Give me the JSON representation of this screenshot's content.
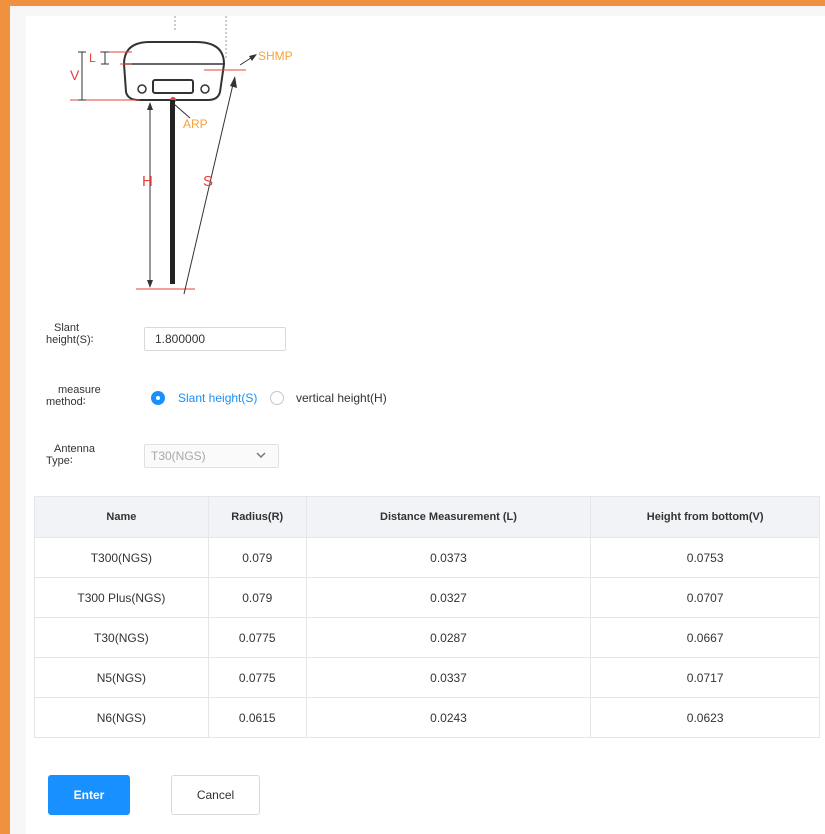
{
  "diagram": {
    "labels": {
      "v": "V",
      "l": "L",
      "shmp": "SHMP",
      "arp": "ARP",
      "h": "H",
      "s": "S"
    }
  },
  "form": {
    "slant_height": {
      "label_line1": "Slant",
      "label_line2": "height(S)∶",
      "value": "1.800000"
    },
    "measure_method": {
      "label_line1": "measure",
      "label_line2": "method∶",
      "options": [
        {
          "label": "Slant height(S)",
          "selected": true
        },
        {
          "label": "vertical height(H)",
          "selected": false
        }
      ]
    },
    "antenna_type": {
      "label_line1": "Antenna",
      "label_line2": "Type∶",
      "value": "T30(NGS)"
    }
  },
  "table": {
    "headers": [
      "Name",
      "Radius(R)",
      "Distance Measurement (L)",
      "Height from bottom(V)"
    ],
    "rows": [
      [
        "T300(NGS)",
        "0.079",
        "0.0373",
        "0.0753"
      ],
      [
        "T300 Plus(NGS)",
        "0.079",
        "0.0327",
        "0.0707"
      ],
      [
        "T30(NGS)",
        "0.0775",
        "0.0287",
        "0.0667"
      ],
      [
        "N5(NGS)",
        "0.0775",
        "0.0337",
        "0.0717"
      ],
      [
        "N6(NGS)",
        "0.0615",
        "0.0243",
        "0.0623"
      ]
    ]
  },
  "buttons": {
    "enter": "Enter",
    "cancel": "Cancel"
  },
  "colors": {
    "accent": "#1890ff",
    "frame": "#f0913f",
    "label_red": "#e8403a",
    "label_orange": "#f7a23b"
  }
}
